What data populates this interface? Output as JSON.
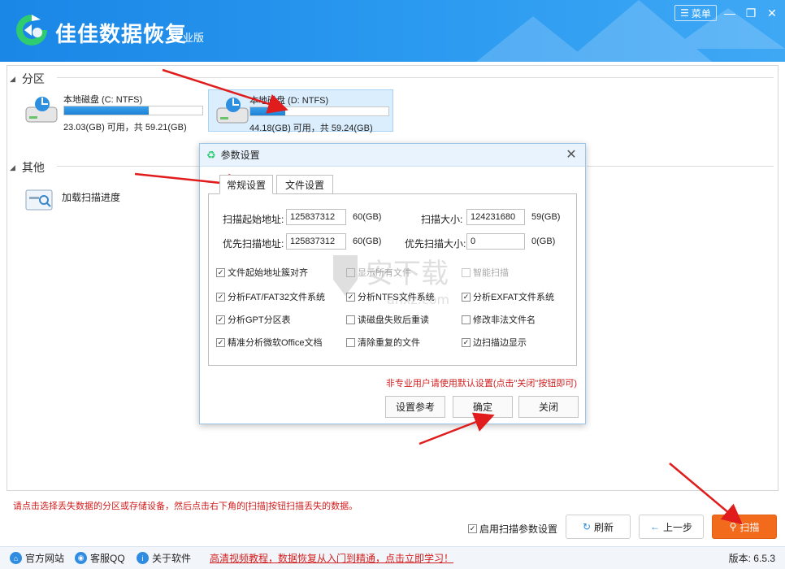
{
  "app": {
    "title": "佳佳数据恢复",
    "edition": "专业版",
    "menu_label": "菜单"
  },
  "partitions": {
    "section_label": "分区",
    "drives": [
      {
        "name": "本地磁盘 (C: NTFS)",
        "info": "23.03(GB) 可用，共 59.21(GB)",
        "used_fraction": 0.61
      },
      {
        "name": "本地磁盘 (D: NTFS)",
        "info": "44.18(GB) 可用，共 59.24(GB)",
        "used_fraction": 0.25
      }
    ]
  },
  "other": {
    "section_label": "其他",
    "load_progress_label": "加载扫描进度"
  },
  "dialog": {
    "title": "参数设置",
    "tabs": [
      "常规设置",
      "文件设置"
    ],
    "fields": {
      "scan_start_label": "扫描起始地址:",
      "scan_start_value": "125837312",
      "scan_start_unit": "60(GB)",
      "scan_size_label": "扫描大小:",
      "scan_size_value": "124231680",
      "scan_size_unit": "59(GB)",
      "priority_start_label": "优先扫描地址:",
      "priority_start_value": "125837312",
      "priority_start_unit": "60(GB)",
      "priority_size_label": "优先扫描大小:",
      "priority_size_value": "0",
      "priority_size_unit": "0(GB)"
    },
    "options": [
      {
        "label": "文件起始地址簇对齐",
        "checked": true,
        "disabled": false
      },
      {
        "label": "显示所有文件",
        "checked": false,
        "disabled": true
      },
      {
        "label": "智能扫描",
        "checked": false,
        "disabled": true
      },
      {
        "label": "分析FAT/FAT32文件系统",
        "checked": true,
        "disabled": false
      },
      {
        "label": "分析NTFS文件系统",
        "checked": true,
        "disabled": false
      },
      {
        "label": "分析EXFAT文件系统",
        "checked": true,
        "disabled": false
      },
      {
        "label": "分析GPT分区表",
        "checked": true,
        "disabled": false
      },
      {
        "label": "读磁盘失败后重读",
        "checked": false,
        "disabled": false
      },
      {
        "label": "修改非法文件名",
        "checked": false,
        "disabled": false
      },
      {
        "label": "精准分析微软Office文档",
        "checked": true,
        "disabled": false
      },
      {
        "label": "清除重复的文件",
        "checked": false,
        "disabled": false
      },
      {
        "label": "边扫描边显示",
        "checked": true,
        "disabled": false
      }
    ],
    "note": "非专业用户请使用默认设置(点击\"关闭\"按钮即可)",
    "buttons": {
      "reference": "设置参考",
      "ok": "确定",
      "close": "关闭"
    }
  },
  "hint": "请点击选择丢失数据的分区或存储设备，然后点击右下角的[扫描]按钮扫描丢失的数据。",
  "controls": {
    "enable_params_label": "启用扫描参数设置",
    "enable_params_checked": true,
    "refresh": "刷新",
    "back": "上一步",
    "scan": "扫描"
  },
  "statusbar": {
    "website": "官方网站",
    "qq": "客服QQ",
    "about": "关于软件",
    "promo": "高清视频教程，数据恢复从入门到精通，点击立即学习！",
    "version": "版本: 6.5.3"
  },
  "watermark": {
    "text": "安下载",
    "sub": "anxz.com"
  },
  "colors": {
    "accent": "#2b9af0",
    "scan_button": "#f26b1d",
    "warning_text": "#d21e1e",
    "arrow": "#e01c1c"
  }
}
